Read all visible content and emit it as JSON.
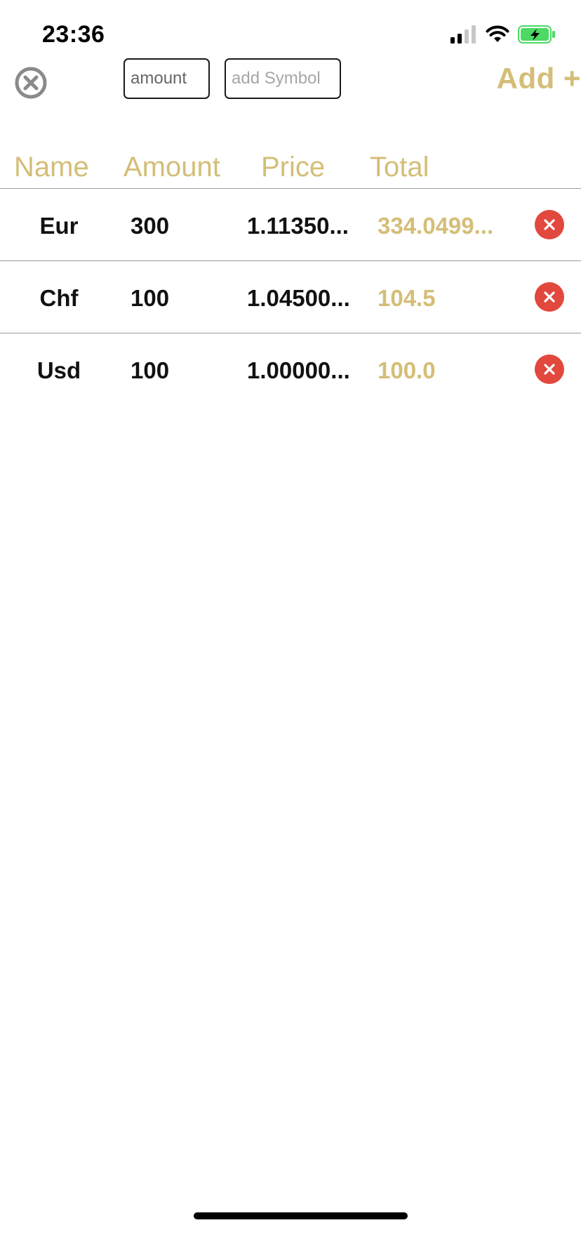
{
  "status_bar": {
    "time": "23:36"
  },
  "toolbar": {
    "amount_placeholder": "amount",
    "symbol_placeholder": "add Symbol",
    "add_label": "Add +"
  },
  "table": {
    "columns": [
      "Name",
      "Amount",
      "Price",
      "Total"
    ],
    "rows": [
      {
        "name": "Eur",
        "amount": "300",
        "price": "1.11350...",
        "total": "334.0499..."
      },
      {
        "name": "Chf",
        "amount": "100",
        "price": "1.04500...",
        "total": "104.5"
      },
      {
        "name": "Usd",
        "amount": "100",
        "price": "1.00000...",
        "total": "100.0"
      }
    ]
  },
  "colors": {
    "accent_gold": "#d4be77",
    "delete_red": "#e2483d",
    "battery_green": "#4cd964"
  },
  "icons": {
    "close": "close-circle-icon",
    "delete": "delete-icon",
    "signal": "signal-icon",
    "wifi": "wifi-icon",
    "battery": "battery-charging-icon"
  }
}
